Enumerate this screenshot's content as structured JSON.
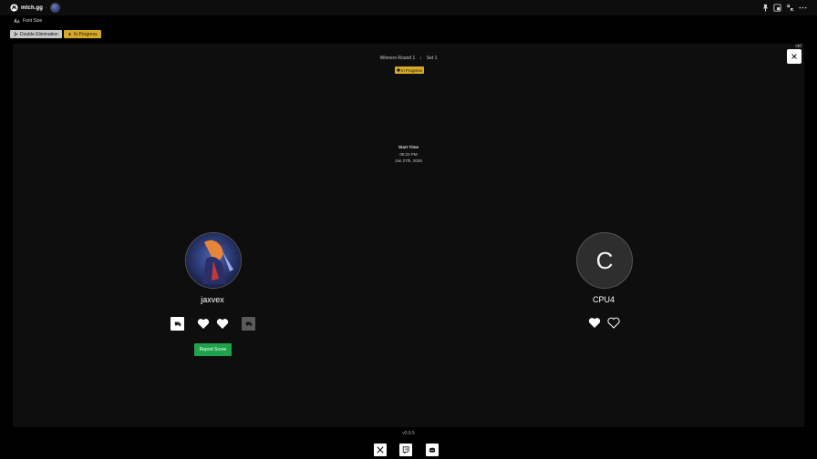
{
  "app": {
    "brand": "mtch.gg",
    "separator": "·"
  },
  "toolbar": {
    "font_size_label": "Font Size"
  },
  "badges": {
    "format": "Double Elimination",
    "status": "In Progress"
  },
  "match": {
    "corner_text": "ctrl",
    "breadcrumb": [
      "Winners Round 1",
      "›",
      "Set 1"
    ],
    "status": "In Progress",
    "start_time_label": "Start Time",
    "start_time": "05:22 PM",
    "start_date": "Jan 27th, 2026"
  },
  "players": [
    {
      "name": "jaxvex",
      "avatar": "image",
      "hearts_filled": 2,
      "hearts_total": 2
    },
    {
      "name": "CPU4",
      "avatar_letter": "C",
      "hearts_filled": 1,
      "hearts_total": 2
    }
  ],
  "actions": {
    "report_score": "Report Score"
  },
  "footer": {
    "version": "v0.9.5",
    "socials": [
      "x-icon",
      "twitch-icon",
      "discord-icon"
    ]
  },
  "colors": {
    "accent_yellow": "#d6a92a",
    "report_green": "#1fa34a",
    "panel_bg": "#0e0e0e"
  }
}
